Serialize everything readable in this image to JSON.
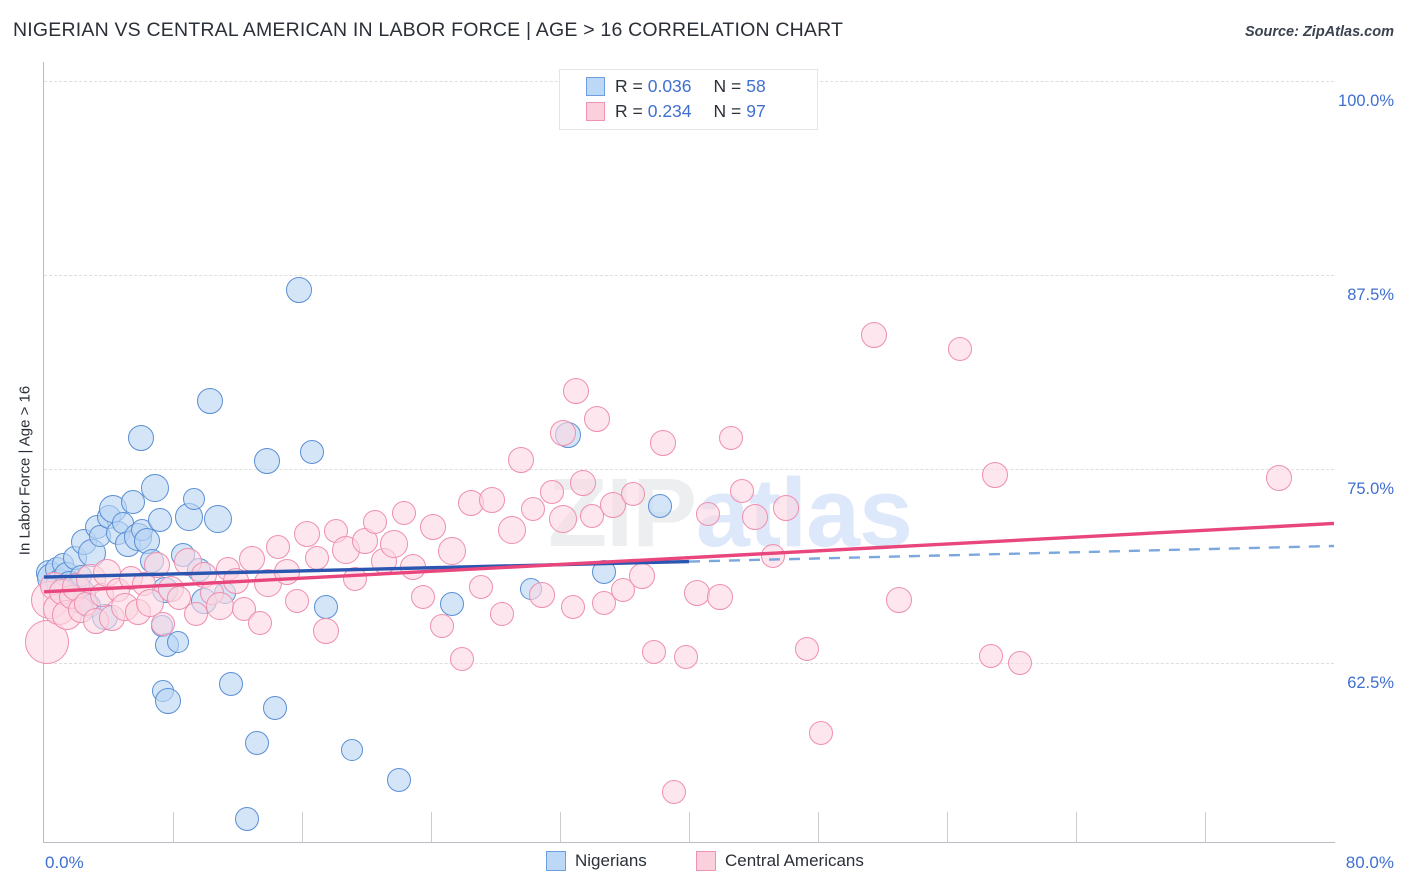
{
  "header": {
    "title": "NIGERIAN VS CENTRAL AMERICAN IN LABOR FORCE | AGE > 16 CORRELATION CHART",
    "source": "Source: ZipAtlas.com"
  },
  "watermark": {
    "part1": "ZIP",
    "part2": "atlas"
  },
  "legend": {
    "rows": [
      {
        "series": "Nigerians",
        "r_label": "R =",
        "r_value": "0.036",
        "n_label": "N =",
        "n_value": "58",
        "color": "#bcd8f7"
      },
      {
        "series": "Central Americans",
        "r_label": "R =",
        "r_value": "0.234",
        "n_label": "N =",
        "n_value": "97",
        "color": "#fbd0dd"
      }
    ]
  },
  "bottom_legend": [
    {
      "label": "Nigerians",
      "color": "#bcd8f7",
      "border": "#6f9ede"
    },
    {
      "label": "Central Americans",
      "color": "#fbd0dd",
      "border": "#f093b2"
    }
  ],
  "axes": {
    "y_title": "In Labor Force | Age > 16",
    "y_ticks": [
      "100.0%",
      "87.5%",
      "75.0%",
      "62.5%"
    ],
    "y_tick_values": [
      100.0,
      87.5,
      75.0,
      62.5
    ],
    "x_ticks": [
      "0.0%",
      "80.0%"
    ],
    "x_min": 0.0,
    "x_max": 80.0,
    "y_min": 51.0,
    "y_max": 101.2
  },
  "colors": {
    "accent_blue": "#3f6fd0",
    "line_blue": "#2b56b0",
    "line_pink": "#e8467c",
    "dot_blue_fill": "#b9d5f4",
    "dot_blue_stroke": "#5b8fd4",
    "dot_pink_fill": "#fcd6e2",
    "dot_pink_stroke": "#ef8fb0",
    "grid": "#dededf",
    "axis": "#b9bcc2"
  },
  "chart_data": {
    "type": "scatter",
    "title": "NIGERIAN VS CENTRAL AMERICAN IN LABOR FORCE | AGE > 16 CORRELATION CHART",
    "xlabel": "",
    "ylabel": "In Labor Force | Age > 16",
    "xlim": [
      0.0,
      80.0
    ],
    "ylim": [
      51.0,
      101.2
    ],
    "grid": true,
    "legend_position": "top-center",
    "series": [
      {
        "name": "Nigerians",
        "color": "#b9d5f4",
        "stroke": "#5b8fd4",
        "R": 0.036,
        "N": 58,
        "trendline": {
          "x0": 0.0,
          "y0": 68.05,
          "x1": 80.0,
          "y1": 70.05,
          "solid_to_x": 40.0,
          "style": "solid-then-dashed",
          "color": "#2b56b0"
        },
        "points": [
          {
            "x": 0.3,
            "y": 68.3,
            "r": 13
          },
          {
            "x": 0.5,
            "y": 68.0,
            "r": 15
          },
          {
            "x": 0.8,
            "y": 68.6,
            "r": 12
          },
          {
            "x": 1.0,
            "y": 67.7,
            "r": 14
          },
          {
            "x": 1.2,
            "y": 68.9,
            "r": 11
          },
          {
            "x": 1.4,
            "y": 68.2,
            "r": 13
          },
          {
            "x": 1.6,
            "y": 67.4,
            "r": 16
          },
          {
            "x": 1.9,
            "y": 69.3,
            "r": 12
          },
          {
            "x": 2.1,
            "y": 66.9,
            "r": 18
          },
          {
            "x": 2.3,
            "y": 68.1,
            "r": 11
          },
          {
            "x": 2.5,
            "y": 70.3,
            "r": 13
          },
          {
            "x": 2.8,
            "y": 66.2,
            "r": 12
          },
          {
            "x": 3.0,
            "y": 69.6,
            "r": 14
          },
          {
            "x": 3.3,
            "y": 71.3,
            "r": 12
          },
          {
            "x": 3.5,
            "y": 70.7,
            "r": 11
          },
          {
            "x": 3.8,
            "y": 65.5,
            "r": 13
          },
          {
            "x": 4.0,
            "y": 71.9,
            "r": 12
          },
          {
            "x": 4.3,
            "y": 72.4,
            "r": 14
          },
          {
            "x": 4.6,
            "y": 70.9,
            "r": 12
          },
          {
            "x": 4.9,
            "y": 71.5,
            "r": 11
          },
          {
            "x": 5.2,
            "y": 70.2,
            "r": 13
          },
          {
            "x": 5.5,
            "y": 72.9,
            "r": 12
          },
          {
            "x": 5.8,
            "y": 70.6,
            "r": 14
          },
          {
            "x": 6.1,
            "y": 71.1,
            "r": 11
          },
          {
            "x": 6.4,
            "y": 70.4,
            "r": 13
          },
          {
            "x": 6.7,
            "y": 69.1,
            "r": 12
          },
          {
            "x": 6.0,
            "y": 77.0,
            "r": 13
          },
          {
            "x": 6.9,
            "y": 73.8,
            "r": 14
          },
          {
            "x": 7.2,
            "y": 71.7,
            "r": 12
          },
          {
            "x": 7.5,
            "y": 67.2,
            "r": 13
          },
          {
            "x": 7.3,
            "y": 64.9,
            "r": 11
          },
          {
            "x": 7.6,
            "y": 63.7,
            "r": 12
          },
          {
            "x": 7.4,
            "y": 60.7,
            "r": 11
          },
          {
            "x": 7.7,
            "y": 60.1,
            "r": 13
          },
          {
            "x": 8.3,
            "y": 63.9,
            "r": 11
          },
          {
            "x": 8.6,
            "y": 69.5,
            "r": 12
          },
          {
            "x": 9.0,
            "y": 71.9,
            "r": 14
          },
          {
            "x": 9.3,
            "y": 73.1,
            "r": 11
          },
          {
            "x": 9.6,
            "y": 68.5,
            "r": 12
          },
          {
            "x": 9.9,
            "y": 66.5,
            "r": 13
          },
          {
            "x": 10.3,
            "y": 79.4,
            "r": 13
          },
          {
            "x": 10.8,
            "y": 71.8,
            "r": 14
          },
          {
            "x": 11.2,
            "y": 67.0,
            "r": 11
          },
          {
            "x": 11.6,
            "y": 61.2,
            "r": 12
          },
          {
            "x": 12.6,
            "y": 52.5,
            "r": 12
          },
          {
            "x": 13.2,
            "y": 57.4,
            "r": 12
          },
          {
            "x": 13.8,
            "y": 75.5,
            "r": 13
          },
          {
            "x": 14.3,
            "y": 59.6,
            "r": 12
          },
          {
            "x": 15.8,
            "y": 86.5,
            "r": 13
          },
          {
            "x": 16.6,
            "y": 76.1,
            "r": 12
          },
          {
            "x": 17.5,
            "y": 66.1,
            "r": 12
          },
          {
            "x": 19.1,
            "y": 56.9,
            "r": 11
          },
          {
            "x": 22.0,
            "y": 55.0,
            "r": 12
          },
          {
            "x": 25.3,
            "y": 66.3,
            "r": 12
          },
          {
            "x": 30.2,
            "y": 67.3,
            "r": 11
          },
          {
            "x": 32.5,
            "y": 77.2,
            "r": 13
          },
          {
            "x": 34.7,
            "y": 68.4,
            "r": 12
          },
          {
            "x": 38.2,
            "y": 72.6,
            "r": 12
          }
        ]
      },
      {
        "name": "Central Americans",
        "color": "#fcd6e2",
        "stroke": "#ef8fb0",
        "R": 0.234,
        "N": 97,
        "trendline": {
          "x0": 0.0,
          "y0": 67.1,
          "x1": 80.0,
          "y1": 71.5,
          "solid_to_x": 80.0,
          "style": "solid",
          "color": "#e8467c"
        },
        "points": [
          {
            "x": 0.2,
            "y": 63.9,
            "r": 22
          },
          {
            "x": 0.4,
            "y": 66.6,
            "r": 19
          },
          {
            "x": 0.6,
            "y": 67.5,
            "r": 14
          },
          {
            "x": 0.9,
            "y": 66.0,
            "r": 16
          },
          {
            "x": 1.1,
            "y": 67.1,
            "r": 13
          },
          {
            "x": 1.4,
            "y": 65.6,
            "r": 15
          },
          {
            "x": 1.7,
            "y": 66.8,
            "r": 12
          },
          {
            "x": 2.0,
            "y": 67.4,
            "r": 14
          },
          {
            "x": 2.3,
            "y": 65.9,
            "r": 13
          },
          {
            "x": 2.6,
            "y": 66.3,
            "r": 12
          },
          {
            "x": 2.9,
            "y": 67.9,
            "r": 15
          },
          {
            "x": 3.2,
            "y": 65.2,
            "r": 13
          },
          {
            "x": 3.6,
            "y": 66.9,
            "r": 12
          },
          {
            "x": 3.9,
            "y": 68.3,
            "r": 14
          },
          {
            "x": 4.2,
            "y": 65.4,
            "r": 13
          },
          {
            "x": 4.6,
            "y": 67.2,
            "r": 12
          },
          {
            "x": 5.0,
            "y": 66.1,
            "r": 14
          },
          {
            "x": 5.4,
            "y": 68.0,
            "r": 12
          },
          {
            "x": 5.8,
            "y": 65.8,
            "r": 13
          },
          {
            "x": 6.2,
            "y": 67.6,
            "r": 12
          },
          {
            "x": 6.6,
            "y": 66.4,
            "r": 14
          },
          {
            "x": 7.0,
            "y": 68.8,
            "r": 13
          },
          {
            "x": 7.4,
            "y": 65.0,
            "r": 12
          },
          {
            "x": 7.9,
            "y": 67.3,
            "r": 13
          },
          {
            "x": 8.4,
            "y": 66.7,
            "r": 12
          },
          {
            "x": 8.9,
            "y": 69.0,
            "r": 14
          },
          {
            "x": 9.4,
            "y": 65.7,
            "r": 12
          },
          {
            "x": 9.9,
            "y": 68.2,
            "r": 13
          },
          {
            "x": 10.4,
            "y": 67.0,
            "r": 12
          },
          {
            "x": 10.9,
            "y": 66.2,
            "r": 14
          },
          {
            "x": 11.4,
            "y": 68.6,
            "r": 12
          },
          {
            "x": 11.9,
            "y": 67.8,
            "r": 13
          },
          {
            "x": 12.4,
            "y": 66.0,
            "r": 12
          },
          {
            "x": 12.9,
            "y": 69.2,
            "r": 13
          },
          {
            "x": 13.4,
            "y": 65.1,
            "r": 12
          },
          {
            "x": 13.9,
            "y": 67.7,
            "r": 14
          },
          {
            "x": 14.5,
            "y": 70.0,
            "r": 12
          },
          {
            "x": 15.1,
            "y": 68.4,
            "r": 13
          },
          {
            "x": 15.7,
            "y": 66.5,
            "r": 12
          },
          {
            "x": 16.3,
            "y": 70.8,
            "r": 13
          },
          {
            "x": 16.9,
            "y": 69.3,
            "r": 12
          },
          {
            "x": 17.5,
            "y": 64.6,
            "r": 13
          },
          {
            "x": 18.1,
            "y": 71.0,
            "r": 12
          },
          {
            "x": 18.7,
            "y": 69.8,
            "r": 14
          },
          {
            "x": 19.3,
            "y": 67.9,
            "r": 12
          },
          {
            "x": 19.9,
            "y": 70.4,
            "r": 13
          },
          {
            "x": 20.5,
            "y": 71.6,
            "r": 12
          },
          {
            "x": 21.1,
            "y": 69.1,
            "r": 13
          },
          {
            "x": 21.7,
            "y": 70.2,
            "r": 14
          },
          {
            "x": 22.3,
            "y": 72.2,
            "r": 12
          },
          {
            "x": 22.9,
            "y": 68.7,
            "r": 13
          },
          {
            "x": 23.5,
            "y": 66.8,
            "r": 12
          },
          {
            "x": 24.1,
            "y": 71.3,
            "r": 13
          },
          {
            "x": 24.7,
            "y": 64.9,
            "r": 12
          },
          {
            "x": 25.3,
            "y": 69.7,
            "r": 14
          },
          {
            "x": 25.9,
            "y": 62.8,
            "r": 12
          },
          {
            "x": 26.5,
            "y": 72.8,
            "r": 13
          },
          {
            "x": 27.1,
            "y": 67.4,
            "r": 12
          },
          {
            "x": 27.8,
            "y": 73.0,
            "r": 13
          },
          {
            "x": 28.4,
            "y": 65.7,
            "r": 12
          },
          {
            "x": 29.0,
            "y": 71.1,
            "r": 14
          },
          {
            "x": 29.6,
            "y": 75.6,
            "r": 13
          },
          {
            "x": 30.3,
            "y": 72.4,
            "r": 12
          },
          {
            "x": 30.9,
            "y": 66.9,
            "r": 13
          },
          {
            "x": 31.5,
            "y": 73.5,
            "r": 12
          },
          {
            "x": 32.2,
            "y": 71.8,
            "r": 14
          },
          {
            "x": 32.8,
            "y": 66.1,
            "r": 12
          },
          {
            "x": 33.4,
            "y": 74.1,
            "r": 13
          },
          {
            "x": 34.0,
            "y": 72.0,
            "r": 12
          },
          {
            "x": 34.3,
            "y": 78.2,
            "r": 13
          },
          {
            "x": 34.7,
            "y": 66.4,
            "r": 12
          },
          {
            "x": 35.3,
            "y": 72.7,
            "r": 13
          },
          {
            "x": 35.9,
            "y": 67.2,
            "r": 12
          },
          {
            "x": 32.2,
            "y": 77.3,
            "r": 13
          },
          {
            "x": 33.0,
            "y": 80.0,
            "r": 13
          },
          {
            "x": 36.5,
            "y": 73.4,
            "r": 12
          },
          {
            "x": 37.1,
            "y": 68.1,
            "r": 13
          },
          {
            "x": 37.8,
            "y": 63.2,
            "r": 12
          },
          {
            "x": 38.4,
            "y": 76.7,
            "r": 13
          },
          {
            "x": 39.1,
            "y": 54.2,
            "r": 12
          },
          {
            "x": 39.8,
            "y": 62.9,
            "r": 12
          },
          {
            "x": 40.5,
            "y": 67.0,
            "r": 13
          },
          {
            "x": 41.2,
            "y": 72.1,
            "r": 12
          },
          {
            "x": 41.9,
            "y": 66.8,
            "r": 13
          },
          {
            "x": 42.6,
            "y": 77.0,
            "r": 12
          },
          {
            "x": 43.3,
            "y": 73.6,
            "r": 12
          },
          {
            "x": 44.1,
            "y": 71.9,
            "r": 13
          },
          {
            "x": 45.2,
            "y": 69.4,
            "r": 12
          },
          {
            "x": 46.0,
            "y": 72.5,
            "r": 13
          },
          {
            "x": 47.3,
            "y": 63.4,
            "r": 12
          },
          {
            "x": 48.2,
            "y": 58.0,
            "r": 12
          },
          {
            "x": 51.5,
            "y": 83.6,
            "r": 13
          },
          {
            "x": 53.0,
            "y": 66.6,
            "r": 13
          },
          {
            "x": 56.8,
            "y": 82.7,
            "r": 12
          },
          {
            "x": 59.0,
            "y": 74.6,
            "r": 13
          },
          {
            "x": 58.7,
            "y": 63.0,
            "r": 12
          },
          {
            "x": 60.5,
            "y": 62.5,
            "r": 12
          },
          {
            "x": 76.6,
            "y": 74.4,
            "r": 13
          }
        ]
      }
    ]
  }
}
